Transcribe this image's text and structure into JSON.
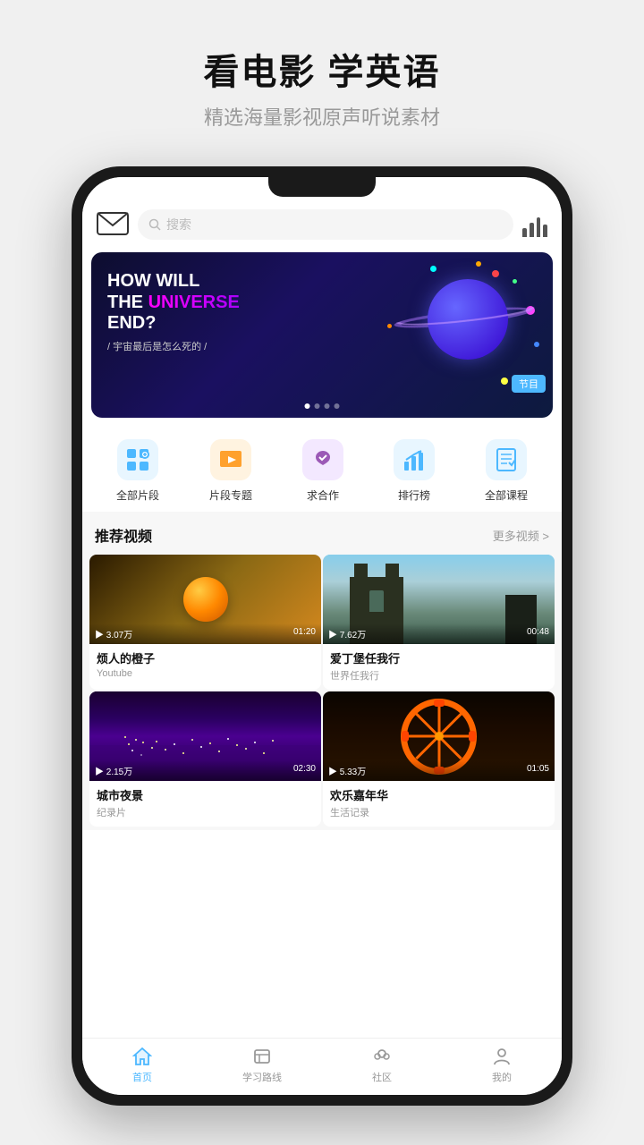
{
  "header": {
    "title": "看电影 学英语",
    "subtitle": "精选海量影视原声听说素材"
  },
  "topNav": {
    "searchPlaceholder": "搜索"
  },
  "banner": {
    "line1": "HOW WILL",
    "line2_prefix": "THE ",
    "line2_highlight": "UNIVERSE",
    "line2_suffix": "",
    "line3": "END?",
    "subtitle": "/ 宇宙最后是怎么死的 /",
    "tag": "节目",
    "dots": [
      true,
      false,
      false,
      false
    ]
  },
  "categories": [
    {
      "id": "all-clips",
      "label": "全部片段",
      "color": "#4db8ff",
      "bg": "#e8f6ff"
    },
    {
      "id": "clip-topics",
      "label": "片段专题",
      "color": "#ff8c00",
      "bg": "#fff3e0"
    },
    {
      "id": "collaborate",
      "label": "求合作",
      "color": "#9b59b6",
      "bg": "#f3e8ff"
    },
    {
      "id": "rankings",
      "label": "排行榜",
      "color": "#4db8ff",
      "bg": "#e8f6ff"
    },
    {
      "id": "all-courses",
      "label": "全部课程",
      "color": "#4db8ff",
      "bg": "#e8f6ff"
    }
  ],
  "recommendSection": {
    "title": "推荐视频",
    "moreLabel": "更多视频 >"
  },
  "videos": [
    {
      "id": "v1",
      "title": "烦人的橙子",
      "source": "Youtube",
      "views": "3.07万",
      "duration": "01:20",
      "thumbType": "orange"
    },
    {
      "id": "v2",
      "title": "爱丁堡任我行",
      "source": "世界任我行",
      "views": "7.62万",
      "duration": "00:48",
      "thumbType": "castle"
    },
    {
      "id": "v3",
      "title": "城市夜景",
      "source": "纪录片",
      "views": "2.15万",
      "duration": "02:30",
      "thumbType": "city"
    },
    {
      "id": "v4",
      "title": "欢乐嘉年华",
      "source": "生活记录",
      "views": "5.33万",
      "duration": "01:05",
      "thumbType": "carnival"
    }
  ],
  "bottomNav": [
    {
      "id": "home",
      "label": "首页",
      "active": true
    },
    {
      "id": "learning",
      "label": "学习路线",
      "active": false
    },
    {
      "id": "community",
      "label": "社区",
      "active": false
    },
    {
      "id": "mine",
      "label": "我的",
      "active": false
    }
  ],
  "icons": {
    "mail": "✉",
    "search": "🔍",
    "chart_bars": "|||",
    "play": "▶"
  }
}
